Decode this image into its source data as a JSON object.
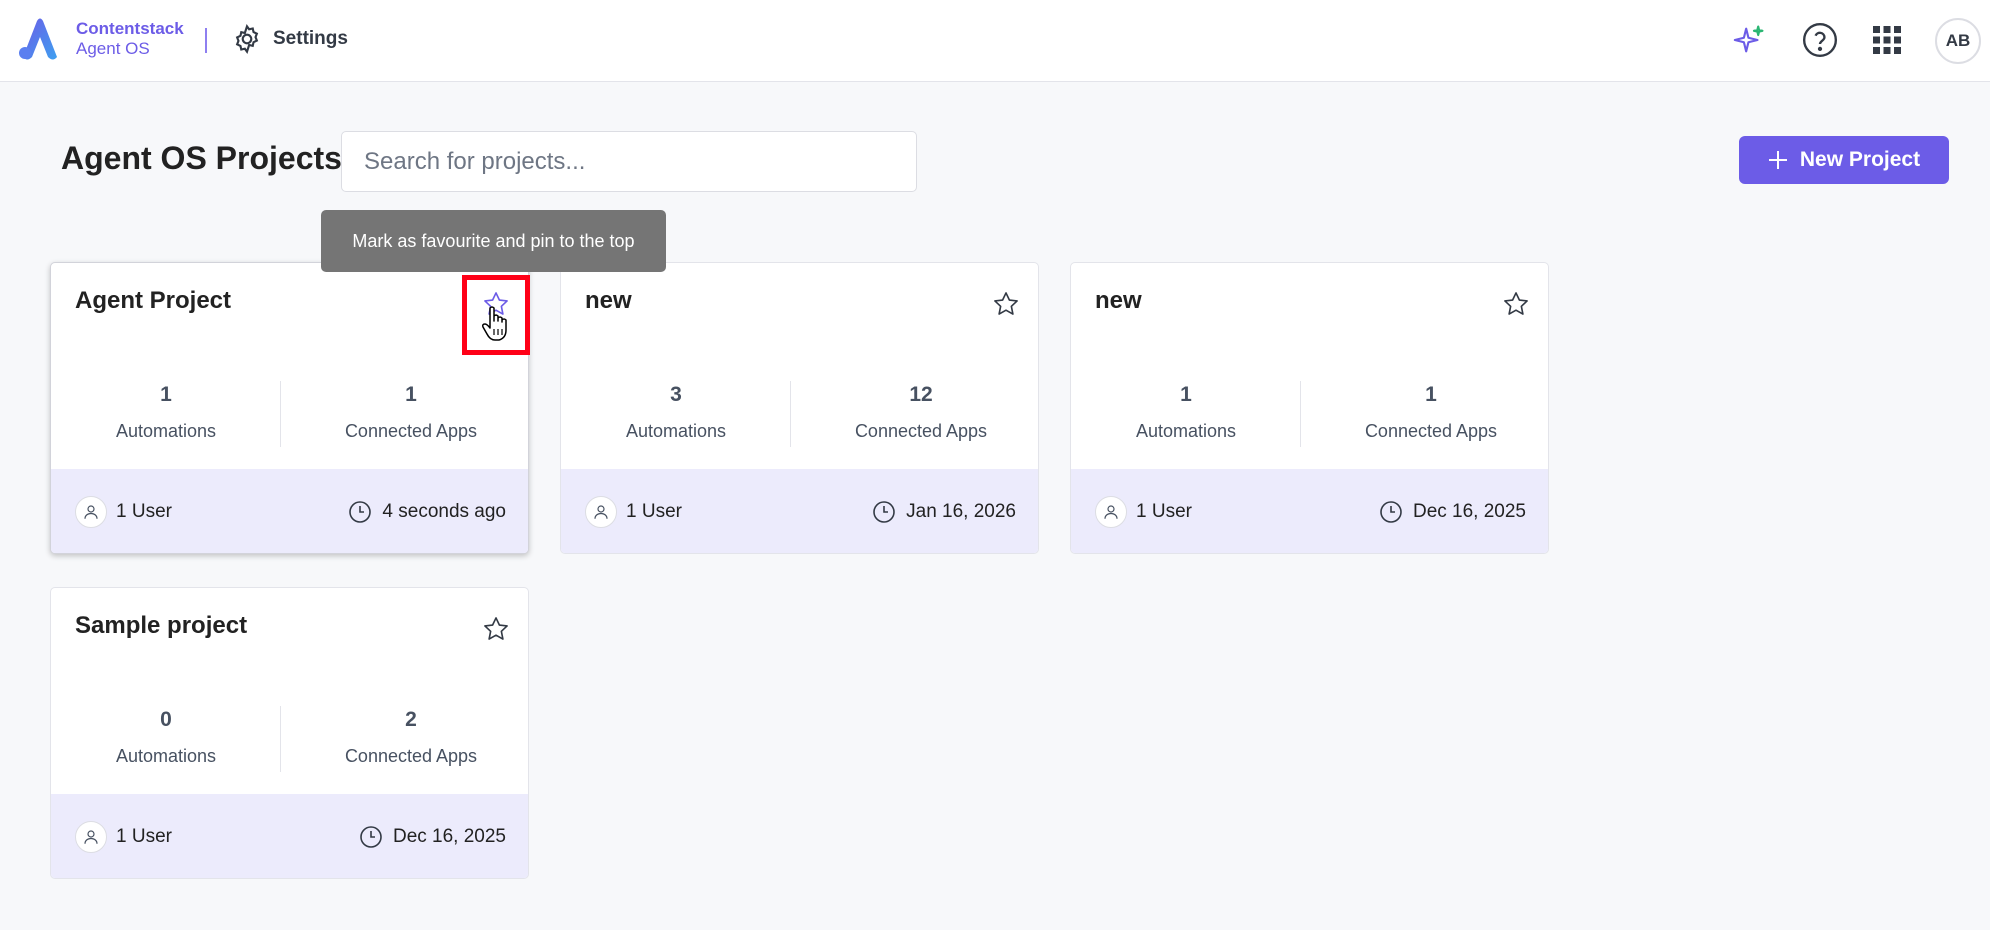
{
  "app": {
    "brand_name": "Contentstack",
    "brand_sub": "Agent OS",
    "settings_label": "Settings",
    "avatar_initials": "AB",
    "accent_color": "#6c5ce7"
  },
  "header_icons": [
    "sparkles-icon",
    "help-circle-icon",
    "apps-grid-icon"
  ],
  "page": {
    "title": "Agent OS Projects",
    "search_placeholder": "Search for projects...",
    "new_project_label": "New Project"
  },
  "tooltip": {
    "text": "Mark as favourite and pin to the top"
  },
  "projects": [
    {
      "name": "Agent Project",
      "automations": "1",
      "automations_label": "Automations",
      "apps": "1",
      "apps_label": "Connected Apps",
      "users": "1 User",
      "updated": "4 seconds ago"
    },
    {
      "name": "new",
      "automations": "3",
      "automations_label": "Automations",
      "apps": "12",
      "apps_label": "Connected Apps",
      "users": "1 User",
      "updated": "Jan 16, 2026"
    },
    {
      "name": "new",
      "automations": "1",
      "automations_label": "Automations",
      "apps": "1",
      "apps_label": "Connected Apps",
      "users": "1 User",
      "updated": "Dec 16, 2025"
    },
    {
      "name": "Sample project",
      "automations": "0",
      "automations_label": "Automations",
      "apps": "2",
      "apps_label": "Connected Apps",
      "users": "1 User",
      "updated": "Dec 16, 2025"
    }
  ]
}
